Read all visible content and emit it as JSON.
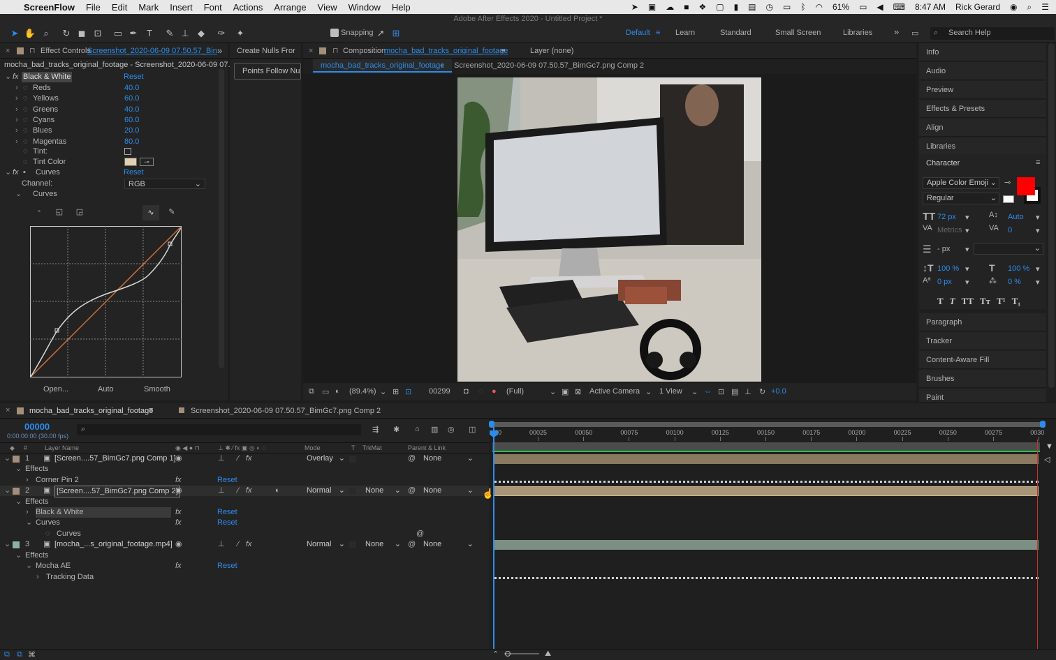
{
  "menubar": {
    "app": "ScreenFlow",
    "items": [
      "File",
      "Edit",
      "Mark",
      "Insert",
      "Font",
      "Actions",
      "Arrange",
      "View",
      "Window",
      "Help"
    ],
    "battery": "61%",
    "time": "8:47 AM",
    "user": "Rick Gerard"
  },
  "window_title": "Adobe After Effects 2020 - Untitled Project *",
  "toolbar": {
    "snapping": "Snapping",
    "workspaces": [
      "Default",
      "Learn",
      "Standard",
      "Small Screen",
      "Libraries"
    ],
    "search_help": "Search Help"
  },
  "effect_controls": {
    "tab_prefix": "Effect Controls",
    "tab_layer": "Screenshot_2020-06-09 07.50.57_Bin",
    "subheader": "mocha_bad_tracks_original_footage - Screenshot_2020-06-09 07.50.57_",
    "bw": {
      "name": "Black & White",
      "reset": "Reset",
      "params": [
        {
          "label": "Reds",
          "value": "40.0"
        },
        {
          "label": "Yellows",
          "value": "60.0"
        },
        {
          "label": "Greens",
          "value": "40.0"
        },
        {
          "label": "Cyans",
          "value": "60.0"
        },
        {
          "label": "Blues",
          "value": "20.0"
        },
        {
          "label": "Magentas",
          "value": "80.0"
        }
      ],
      "tint": "Tint:",
      "tint_color": "Tint Color"
    },
    "curves": {
      "name": "Curves",
      "reset": "Reset",
      "channel_label": "Channel:",
      "channel_value": "RGB",
      "curves_label": "Curves",
      "open": "Open...",
      "auto": "Auto",
      "smooth": "Smooth"
    }
  },
  "script_panel": {
    "title": "Create Nulls Fror",
    "button": "Points Follow Null"
  },
  "composition": {
    "tab_prefix": "Composition",
    "tab_name": "mocha_bad_tracks_original_footage",
    "layer_tab": "Layer (none)",
    "breadcrumbs": [
      "mocha_bad_tracks_original_footage",
      "Screenshot_2020-06-09 07.50.57_BimGc7.png Comp 2"
    ],
    "footer": {
      "zoom": "(89.4%)",
      "frame": "00299",
      "resolution": "(Full)",
      "camera": "Active Camera",
      "views": "1 View",
      "exposure": "+0.0"
    }
  },
  "right_panel": {
    "items": [
      "Info",
      "Audio",
      "Preview",
      "Effects & Presets",
      "Align",
      "Libraries"
    ],
    "character": {
      "title": "Character",
      "font": "Apple Color Emoji",
      "style": "Regular",
      "size": "72 px",
      "leading": "Auto",
      "kerning": "Metrics",
      "tracking": "0",
      "stroke": "- px",
      "vscale": "100 %",
      "hscale": "100 %",
      "baseline": "0 px",
      "tsume": "0 %",
      "fill_color": "#ff0000"
    },
    "after": [
      "Paragraph",
      "Tracker",
      "Content-Aware Fill",
      "Brushes",
      "Paint"
    ]
  },
  "timeline": {
    "tab": "mocha_bad_tracks_original_footage",
    "tab2": "Screenshot_2020-06-09 07.50.57_BimGc7.png Comp 2",
    "timecode": "00000",
    "fps": "0:00:00:00 (30.00 fps)",
    "columns": {
      "layer_name": "Layer Name",
      "mode": "Mode",
      "t": "T",
      "trkmat": "TrkMat",
      "parent": "Parent & Link"
    },
    "ruler": [
      "00025",
      "00050",
      "00075",
      "00100",
      "00125",
      "00150",
      "00175",
      "00200",
      "00225",
      "00250",
      "00275",
      "0030"
    ],
    "ruler_start": "00",
    "rows": [
      {
        "kind": "layer",
        "num": "1",
        "name": "[Screen....57_BimGc7.png Comp 1]",
        "mode": "Overlay",
        "trkmat": "",
        "parent": "None"
      },
      {
        "kind": "effects",
        "label": "Effects"
      },
      {
        "kind": "effect",
        "label": "Corner Pin 2",
        "reset": "Reset"
      },
      {
        "kind": "layer",
        "num": "2",
        "name": "[Screen....57_BimGc7.png Comp 2]",
        "mode": "Normal",
        "trkmat": "None",
        "parent": "None"
      },
      {
        "kind": "effects",
        "label": "Effects"
      },
      {
        "kind": "effect",
        "label": "Black & White",
        "reset": "Reset"
      },
      {
        "kind": "effect",
        "label": "Curves",
        "reset": "Reset"
      },
      {
        "kind": "prop",
        "label": "Curves"
      },
      {
        "kind": "layer",
        "num": "3",
        "name": "[mocha_...s_original_footage.mp4]",
        "mode": "Normal",
        "trkmat": "None",
        "parent": "None"
      },
      {
        "kind": "effects",
        "label": "Effects"
      },
      {
        "kind": "effect",
        "label": "Mocha AE",
        "reset": "Reset"
      },
      {
        "kind": "prop",
        "label": "Tracking Data"
      }
    ]
  }
}
